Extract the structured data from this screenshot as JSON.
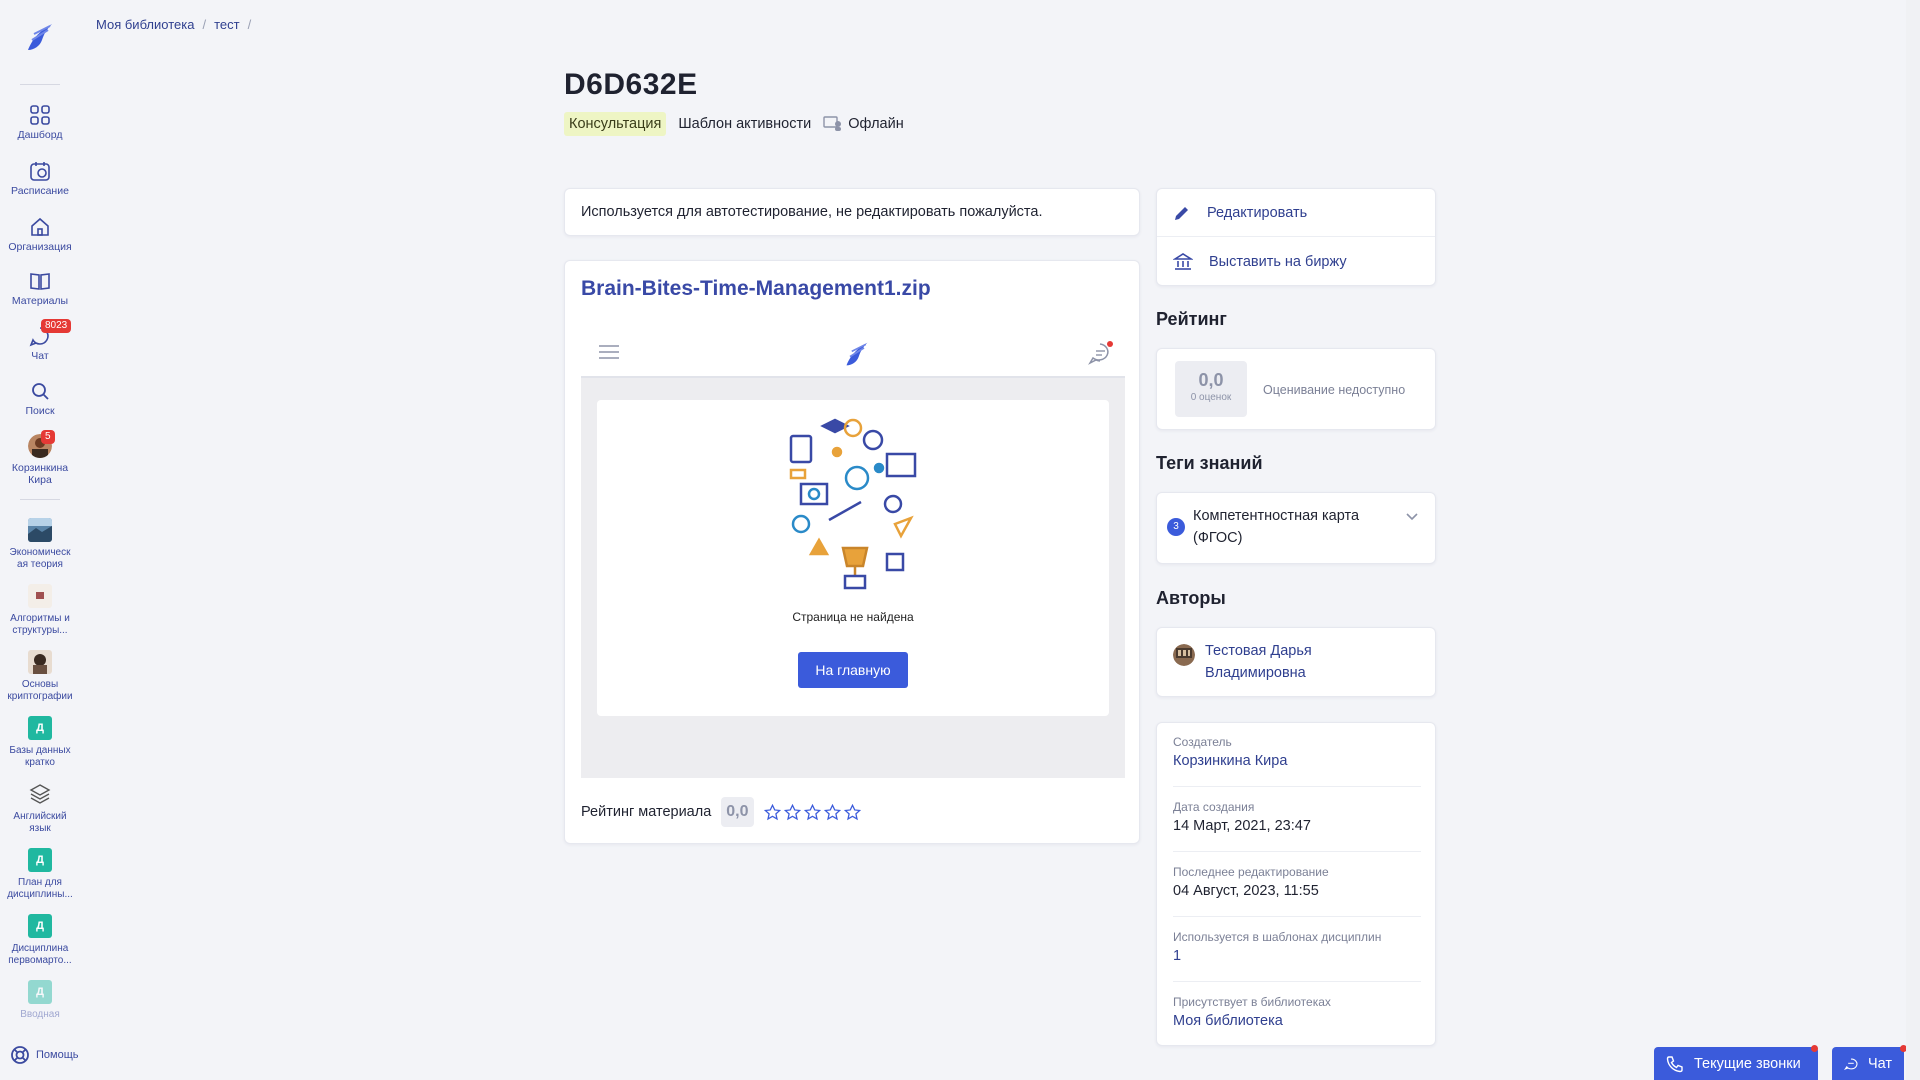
{
  "breadcrumb": [
    "Моя библиотека",
    "тест"
  ],
  "sidebar": {
    "items": [
      {
        "label": "Дашборд",
        "icon": "grid-icon"
      },
      {
        "label": "Расписание",
        "icon": "calendar-icon"
      },
      {
        "label": "Организация",
        "icon": "home-icon"
      },
      {
        "label": "Материалы",
        "icon": "book-icon"
      },
      {
        "label": "Чат",
        "icon": "chat-icon",
        "badge": "8023"
      },
      {
        "label": "Поиск",
        "icon": "search-icon"
      }
    ],
    "profile": {
      "label_line1": "Корзинкина",
      "label_line2": "Кира",
      "badge": "5"
    },
    "courses": [
      {
        "line1": "Экономическ",
        "line2": "ая теория"
      },
      {
        "line1": "Алгоритмы и",
        "line2": "структуры..."
      },
      {
        "line1": "Основы",
        "line2": "криптографии"
      },
      {
        "line1": "Базы данных",
        "line2": "кратко",
        "letter": "Д"
      },
      {
        "line1": "Английский",
        "line2": "язык"
      },
      {
        "line1": "План для",
        "line2": "дисциплины...",
        "letter": "Д"
      },
      {
        "line1": "Дисциплина",
        "line2": "первомарто...",
        "letter": "Д"
      },
      {
        "line1": "Вводная",
        "line2": "",
        "letter": "Д"
      }
    ],
    "help": "Помощь"
  },
  "header": {
    "title": "D6D632E",
    "type_tag": "Консультация",
    "template": "Шаблон активности",
    "format": "Офлайн"
  },
  "description": "Используется для автотестирование, не редактировать пожалуйста.",
  "file": {
    "name": "Brain-Bites-Time-Management1.zip",
    "not_found": "Страница не найдена",
    "home_button": "На главную"
  },
  "material_rating": {
    "label": "Рейтинг материала",
    "value": "0,0",
    "stars": 0
  },
  "actions": {
    "edit": "Редактировать",
    "exchange": "Выставить на биржу"
  },
  "rating": {
    "title": "Рейтинг",
    "value": "0,0",
    "count": "0 оценок",
    "status": "Оценивание недоступно"
  },
  "tags": {
    "title": "Теги знаний",
    "count": "3",
    "name_line1": "Компетентностная карта",
    "name_line2": "(ФГОС)"
  },
  "authors": {
    "title": "Авторы",
    "name_line1": "Тестовая Дарья",
    "name_line2": "Владимировна"
  },
  "info": {
    "creator_label": "Создатель",
    "creator": "Корзинкина Кира",
    "created_label": "Дата создания",
    "created": "14 Март, 2021, 23:47",
    "edited_label": "Последнее редактирование",
    "edited": "04 Август, 2023, 11:55",
    "used_label": "Используется в шаблонах дисциплин",
    "used": "1",
    "libs_label": "Присутствует в библиотеках",
    "libs": "Моя библиотека"
  },
  "floating": {
    "calls": "Текущие звонки",
    "chat": "Чат"
  },
  "colors": {
    "accent": "#3b5bdb",
    "link": "#2f3f8f",
    "badge": "#e53935",
    "tag_bg": "#eef5c4"
  }
}
